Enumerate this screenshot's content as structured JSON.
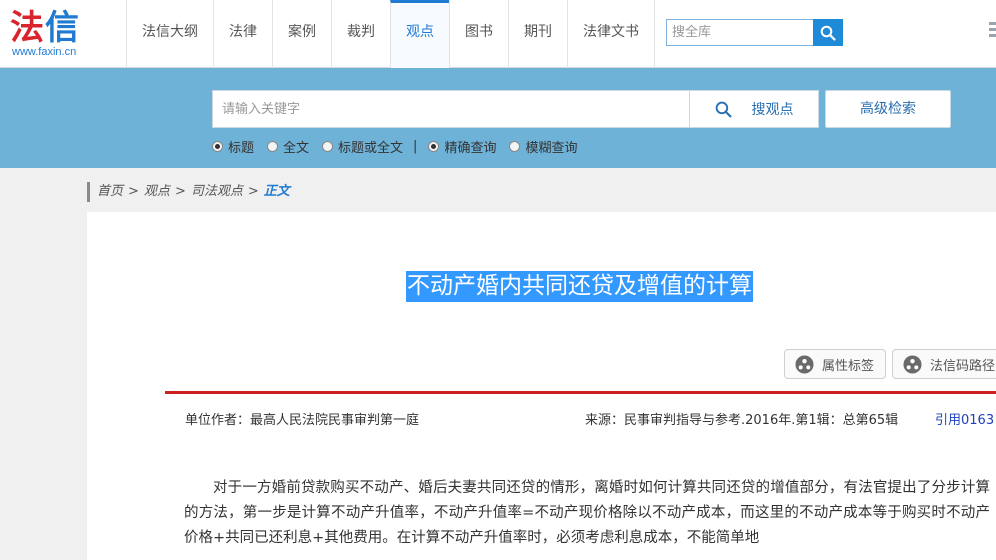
{
  "logo": {
    "char1": "法",
    "char2": "信",
    "url": "www.faxin.cn"
  },
  "nav": [
    {
      "label": "法信大纲",
      "active": false
    },
    {
      "label": "法律",
      "active": false
    },
    {
      "label": "案例",
      "active": false
    },
    {
      "label": "裁判",
      "active": false
    },
    {
      "label": "观点",
      "active": true
    },
    {
      "label": "图书",
      "active": false
    },
    {
      "label": "期刊",
      "active": false
    },
    {
      "label": "法律文书",
      "active": false
    }
  ],
  "top_search": {
    "placeholder": "搜全库"
  },
  "search": {
    "placeholder": "请输入关键字",
    "button": "搜观点",
    "advanced": "高级检索",
    "scope_options": [
      "标题",
      "全文",
      "标题或全文"
    ],
    "scope_selected": "标题",
    "mode_options": [
      "精确查询",
      "模糊查询"
    ],
    "mode_selected": "精确查询"
  },
  "breadcrumb": {
    "home": "首页",
    "level1": "观点",
    "level2": "司法观点",
    "current": "正文"
  },
  "article": {
    "title": "不动产婚内共同还贷及增值的计算",
    "tag_button": "属性标签",
    "code_button": "法信码路径",
    "author": "单位作者：最高人民法院民事审判第一庭",
    "source": "来源：民事审判指导与参考.2016年.第1辑：总第65辑",
    "cite": "引用0163",
    "body": "对于一方婚前贷款购买不动产、婚后夫妻共同还贷的情形，离婚时如何计算共同还贷的增值部分，有法官提出了分步计算的方法，第一步是计算不动产升值率，不动产升值率=不动产现价格除以不动产成本，而这里的不动产成本等于购买时不动产价格+共同已还利息+其他费用。在计算不动产升值率时，必须考虑利息成本，不能简单地"
  },
  "colors": {
    "brand_blue": "#1f7ad1",
    "brand_red": "#d9232d",
    "band": "#6fb2d8",
    "highlight": "#3399ff",
    "rule": "#cc2020"
  }
}
